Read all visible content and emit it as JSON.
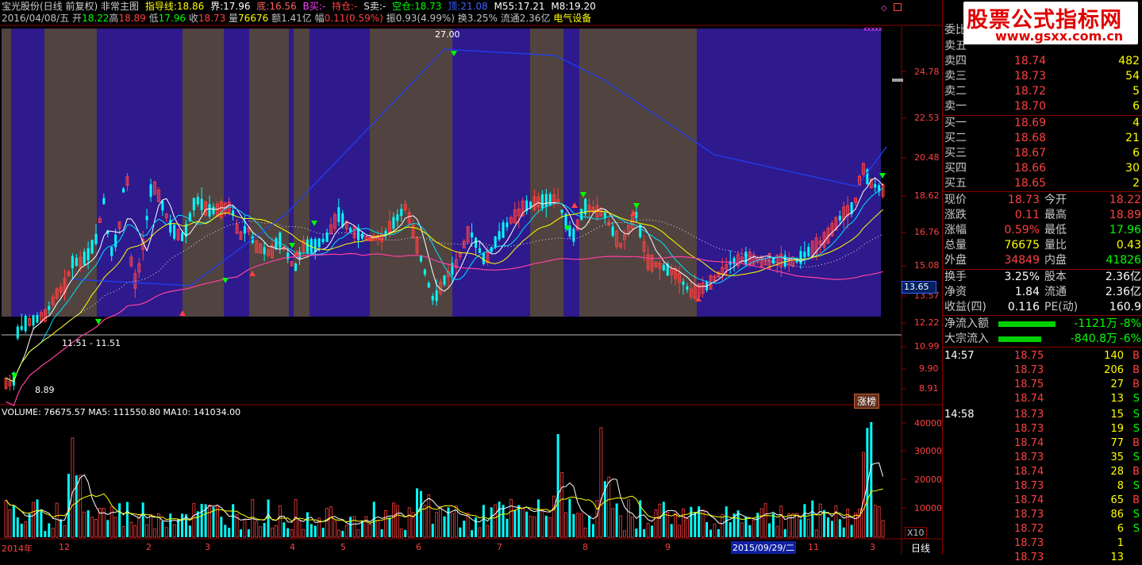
{
  "header": {
    "line1": {
      "stock": "宝光股份(日线 前复权) 非常主图",
      "guide_label": "指导线:",
      "guide": "18.86",
      "jie_label": "界:",
      "jie": "17.96",
      "di_label": "底:",
      "di": "16.56",
      "bbuy_label": "B买:",
      "bbuy": "-",
      "hold_label": "持仓:",
      "hold": "-",
      "ssell_label": "S卖:",
      "ssell": "-",
      "empty_label": "空仓:",
      "empty": "18.73",
      "top_label": "顶:",
      "top": "21.08",
      "m55_label": "M55:",
      "m55": "17.21",
      "m8_label": "M8:",
      "m8": "19.20"
    },
    "line2": {
      "date": "2016/04/08/五",
      "open_label": "开",
      "open": "18.22",
      "high_label": "高",
      "high": "18.89",
      "low_label": "低",
      "low": "17.96",
      "close_label": "收",
      "close": "18.73",
      "vol_label": "量",
      "vol": "76676",
      "amt_label": "额",
      "amt": "1.41亿",
      "chg_label": "幅",
      "chg": "0.11(0.59%)",
      "amp_label": "振",
      "amp": "0.93(4.99%)",
      "turn_label": "换",
      "turn": "3.25%",
      "float_label": "流通",
      "float": "2.36亿",
      "industry": "电气设备"
    }
  },
  "price_axis": [
    "24.78",
    "22.53",
    "20.48",
    "18.62",
    "16.76",
    "15.08",
    "13.57",
    "12.22",
    "10.99",
    "9.90",
    "8.91"
  ],
  "current_price_tag": "13.65",
  "annotations": {
    "high": "27.00",
    "low": "8.89",
    "range": "11.51 - 11.51",
    "ranking_button": "涨榜"
  },
  "volume": {
    "header": "VOLUME: 76675.57  MA5: 111550.80  MA10: 141034.00",
    "axis": [
      "40000",
      "30000",
      "20000",
      "10000"
    ],
    "unit": "X10"
  },
  "time_axis": {
    "labels": [
      "2014年",
      "12",
      "2",
      "3",
      "4",
      "5",
      "6",
      "7",
      "8",
      "9",
      "11",
      "3"
    ],
    "selected_date": "2015/09/29/二",
    "period": "日线"
  },
  "watermark": {
    "title": "股票公式指标网",
    "url": "www.gsxx.com.cn"
  },
  "order_book": {
    "header_partial": "委比",
    "asks": [
      {
        "label": "卖五",
        "price": "",
        "vol": ""
      },
      {
        "label": "卖四",
        "price": "18.74",
        "vol": "482"
      },
      {
        "label": "卖三",
        "price": "18.73",
        "vol": "54"
      },
      {
        "label": "卖二",
        "price": "18.72",
        "vol": "5"
      },
      {
        "label": "卖一",
        "price": "18.70",
        "vol": "6"
      }
    ],
    "bids": [
      {
        "label": "买一",
        "price": "18.69",
        "vol": "4"
      },
      {
        "label": "买二",
        "price": "18.68",
        "vol": "21"
      },
      {
        "label": "买三",
        "price": "18.67",
        "vol": "6"
      },
      {
        "label": "买四",
        "price": "18.66",
        "vol": "30"
      },
      {
        "label": "买五",
        "price": "18.65",
        "vol": "2"
      }
    ]
  },
  "quote": [
    {
      "l1": "现价",
      "v1": "18.73",
      "l2": "今开",
      "v2": "18.22"
    },
    {
      "l1": "涨跌",
      "v1": "0.11",
      "l2": "最高",
      "v2": "18.89"
    },
    {
      "l1": "涨幅",
      "v1": "0.59%",
      "l2": "最低",
      "v2": "17.96"
    },
    {
      "l1": "总量",
      "v1": "76675",
      "l2": "量比",
      "v2": "0.43"
    },
    {
      "l1": "外盘",
      "v1": "34849",
      "l2": "内盘",
      "v2": "41826"
    }
  ],
  "stats": [
    {
      "l1": "换手",
      "v1": "3.25%",
      "l2": "股本",
      "v2": "2.36亿"
    },
    {
      "l1": "净资",
      "v1": "1.84",
      "l2": "流通",
      "v2": "2.36亿"
    },
    {
      "l1": "收益(四)",
      "v1": "0.116",
      "l2": "PE(动)",
      "v2": "160.9"
    }
  ],
  "flows": [
    {
      "label": "净流入额",
      "value": "-1121万",
      "pct": "-8%",
      "bar": 0.6
    },
    {
      "label": "大宗流入",
      "value": "-840.8万",
      "pct": "-6%",
      "bar": 0.45
    }
  ],
  "trades": [
    {
      "time": "14:57",
      "price": "18.75",
      "vol": "140",
      "side": "B"
    },
    {
      "time": "",
      "price": "18.73",
      "vol": "206",
      "side": "B"
    },
    {
      "time": "",
      "price": "18.75",
      "vol": "27",
      "side": "B"
    },
    {
      "time": "",
      "price": "18.74",
      "vol": "13",
      "side": "S"
    },
    {
      "time": "14:58",
      "price": "18.73",
      "vol": "15",
      "side": "S"
    },
    {
      "time": "",
      "price": "18.73",
      "vol": "19",
      "side": "S"
    },
    {
      "time": "",
      "price": "18.74",
      "vol": "77",
      "side": "B"
    },
    {
      "time": "",
      "price": "18.73",
      "vol": "35",
      "side": "S"
    },
    {
      "time": "",
      "price": "18.74",
      "vol": "28",
      "side": "B"
    },
    {
      "time": "",
      "price": "18.73",
      "vol": "8",
      "side": "S"
    },
    {
      "time": "",
      "price": "18.74",
      "vol": "65",
      "side": "B"
    },
    {
      "time": "",
      "price": "18.73",
      "vol": "86",
      "side": "S"
    },
    {
      "time": "",
      "price": "18.72",
      "vol": "6",
      "side": "S"
    },
    {
      "time": "",
      "price": "18.73",
      "vol": "1",
      "side": ""
    },
    {
      "time": "",
      "price": "18.73",
      "vol": "13",
      "side": ""
    }
  ],
  "colors": {
    "up": "#ff4040",
    "down": "#00ffff",
    "ma_white": "#ffffff",
    "ma_yellow": "#ffff00",
    "ma_cyan": "#00e0ff",
    "ma_blue": "#2040ff",
    "ma_pink": "#ff40a0",
    "band_blue": "#2e1a8c",
    "band_gray": "#514340",
    "grid": "#8b0000"
  }
}
